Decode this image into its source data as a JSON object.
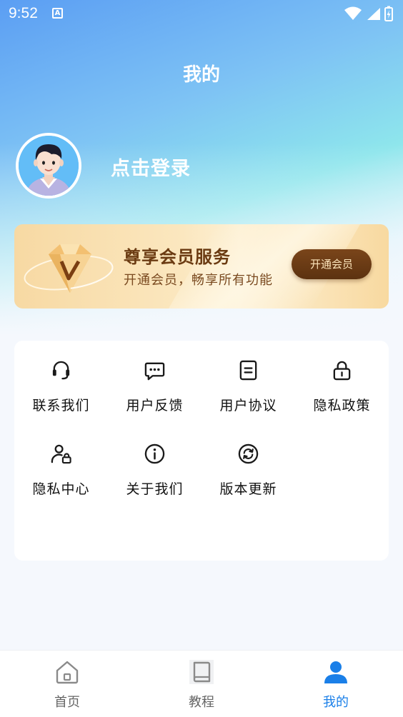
{
  "status_bar": {
    "time": "9:52",
    "notification_letter": "A"
  },
  "header": {
    "title": "我的"
  },
  "profile": {
    "login_label": "点击登录"
  },
  "vip": {
    "title": "尊享会员服务",
    "subtitle": "开通会员，畅享所有功能",
    "button_label": "开通会员",
    "accent_color": "#5c3210"
  },
  "menu": {
    "items": [
      {
        "label": "联系我们",
        "icon": "headset-icon"
      },
      {
        "label": "用户反馈",
        "icon": "chat-bubble-icon"
      },
      {
        "label": "用户协议",
        "icon": "document-icon"
      },
      {
        "label": "隐私政策",
        "icon": "lock-icon"
      },
      {
        "label": "隐私中心",
        "icon": "user-lock-icon"
      },
      {
        "label": "关于我们",
        "icon": "info-icon"
      },
      {
        "label": "版本更新",
        "icon": "refresh-icon"
      }
    ]
  },
  "bottom_nav": {
    "items": [
      {
        "label": "首页",
        "icon": "home-icon"
      },
      {
        "label": "教程",
        "icon": "book-icon"
      },
      {
        "label": "我的",
        "icon": "person-icon"
      }
    ],
    "active_color": "#1a7fe8"
  }
}
